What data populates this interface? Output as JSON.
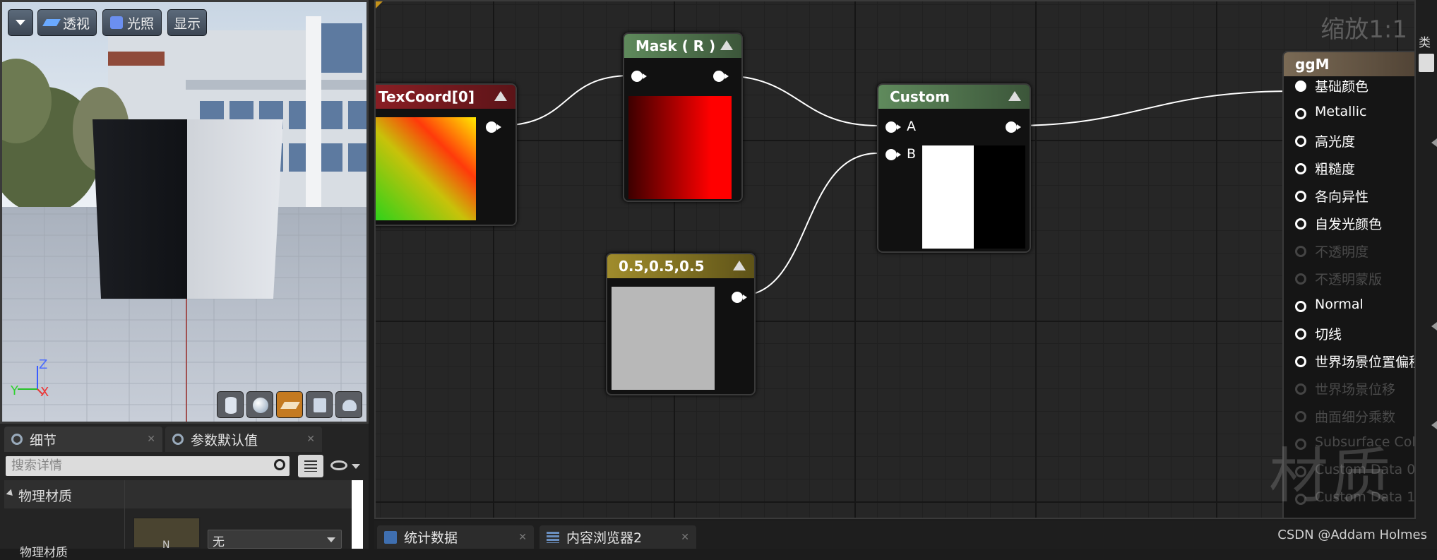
{
  "viewport": {
    "perspective_label": "透视",
    "lighting_label": "光照",
    "show_label": "显示",
    "axis_z": "Z",
    "axis_y": "Y",
    "axis_x": "X"
  },
  "details": {
    "tab_details": "细节",
    "tab_param_defaults": "参数默认值",
    "search_placeholder": "搜索详情",
    "category": "物理材质",
    "row_label": "物理材质",
    "thumb_letter": "N",
    "dropdown_value": "无"
  },
  "graph": {
    "zoom_label": "缩放1:1",
    "nodes": {
      "texcoord": "TexCoord[0]",
      "mask": "Mask ( R )",
      "custom": "Custom",
      "custom_pin_a": "A",
      "custom_pin_b": "B",
      "constant": "0.5,0.5,0.5"
    },
    "ggm": {
      "title": "ggM",
      "pins": [
        {
          "label": "基础颜色",
          "state": "connected"
        },
        {
          "label": "Metallic",
          "state": "active"
        },
        {
          "label": "高光度",
          "state": "active"
        },
        {
          "label": "粗糙度",
          "state": "active"
        },
        {
          "label": "各向异性",
          "state": "active"
        },
        {
          "label": "自发光颜色",
          "state": "active"
        },
        {
          "label": "不透明度",
          "state": "disabled"
        },
        {
          "label": "不透明蒙版",
          "state": "disabled"
        },
        {
          "label": "Normal",
          "state": "active"
        },
        {
          "label": "切线",
          "state": "active"
        },
        {
          "label": "世界场景位置偏移",
          "state": "active"
        },
        {
          "label": "世界场景位移",
          "state": "disabled"
        },
        {
          "label": "曲面细分乘数",
          "state": "disabled"
        },
        {
          "label": "Subsurface Color",
          "state": "disabled"
        },
        {
          "label": "Custom Data 0",
          "state": "disabled"
        },
        {
          "label": "Custom Data 1",
          "state": "disabled"
        }
      ]
    },
    "watermark": "材质"
  },
  "bottom": {
    "tab_stats": "统计数据",
    "tab_content_browser": "内容浏览器2",
    "credit": "CSDN @Addam Holmes"
  },
  "right_strip": {
    "label": "类"
  },
  "colors": {
    "texcoord_header": "#8c1f25",
    "mask_header": "#4f6e4d",
    "custom_header": "#4f6e4d",
    "constant_header": "#8a7a2a",
    "ggm_header": "#7a6a55",
    "constant_swatch": "#b8b8b8"
  }
}
